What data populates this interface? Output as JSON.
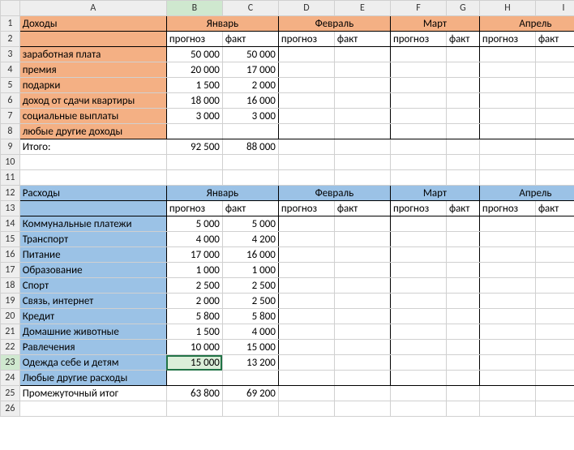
{
  "columns": [
    "",
    "A",
    "B",
    "C",
    "D",
    "E",
    "F",
    "G",
    "H",
    "I"
  ],
  "months": [
    "Январь",
    "Февраль",
    "Март",
    "Апрель"
  ],
  "subheaders": {
    "forecast": "прогноз",
    "fact": "факт"
  },
  "income": {
    "title": "Доходы",
    "total_label": "Итого:",
    "items": [
      {
        "name": "заработная плата",
        "forecast": "50 000",
        "fact": "50 000"
      },
      {
        "name": "премия",
        "forecast": "20 000",
        "fact": "17 000"
      },
      {
        "name": "подарки",
        "forecast": "1 500",
        "fact": "2 000"
      },
      {
        "name": "доход от сдачи квартиры",
        "forecast": "18 000",
        "fact": "16 000"
      },
      {
        "name": "социальные выплаты",
        "forecast": "3 000",
        "fact": "3 000"
      },
      {
        "name": "любые другие доходы",
        "forecast": "",
        "fact": ""
      }
    ],
    "total": {
      "forecast": "92 500",
      "fact": "88 000"
    }
  },
  "expenses": {
    "title": "Расходы",
    "subtotal_label": "Промежуточный итог",
    "items": [
      {
        "name": "Коммунальные платежи",
        "forecast": "5 000",
        "fact": "5 000"
      },
      {
        "name": "Транспорт",
        "forecast": "4 000",
        "fact": "4 200"
      },
      {
        "name": "Питание",
        "forecast": "17 000",
        "fact": "16 000"
      },
      {
        "name": "Образование",
        "forecast": "1 000",
        "fact": "1 000"
      },
      {
        "name": "Спорт",
        "forecast": "2 500",
        "fact": "2 500"
      },
      {
        "name": "Связь, интернет",
        "forecast": "2 000",
        "fact": "2 500"
      },
      {
        "name": "Кредит",
        "forecast": "5 800",
        "fact": "5 800"
      },
      {
        "name": "Домашние животные",
        "forecast": "1 500",
        "fact": "4 000"
      },
      {
        "name": "Равлечения",
        "forecast": "10 000",
        "fact": "15 000"
      },
      {
        "name": "Одежда себе и детям",
        "forecast": "15 000",
        "fact": "13 200"
      },
      {
        "name": "Любые другие расходы",
        "forecast": "",
        "fact": ""
      }
    ],
    "subtotal": {
      "forecast": "63 800",
      "fact": "69 200"
    }
  },
  "partialSubHeadI": "п"
}
